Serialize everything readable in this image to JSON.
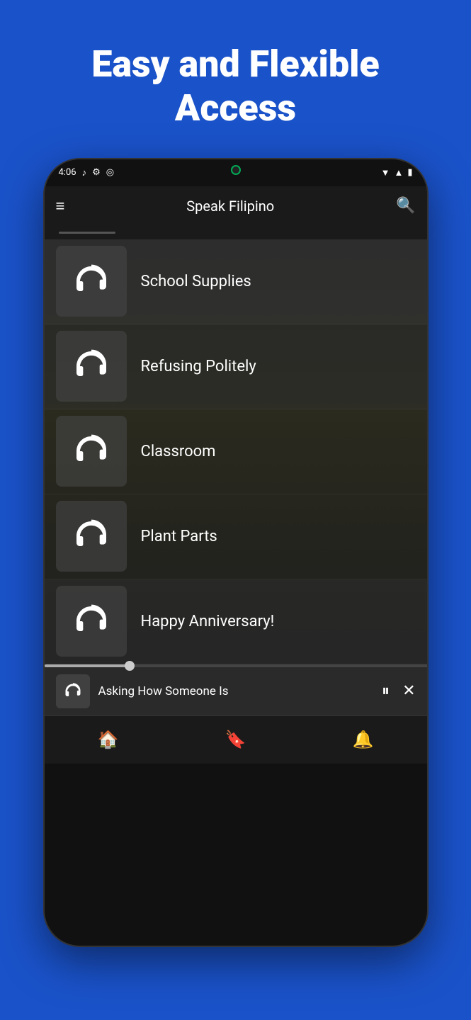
{
  "hero": {
    "title": "Easy and Flexible Access"
  },
  "statusBar": {
    "time": "4:06",
    "leftIcons": [
      "♪",
      "⚙",
      "◎"
    ],
    "rightIcons": [
      "▼",
      "▲",
      "🔋"
    ]
  },
  "appBar": {
    "title": "Speak Filipino",
    "menuLabel": "≡",
    "searchLabel": "🔍"
  },
  "listItems": [
    {
      "id": 1,
      "label": "School Supplies"
    },
    {
      "id": 2,
      "label": "Refusing Politely"
    },
    {
      "id": 3,
      "label": "Classroom"
    },
    {
      "id": 4,
      "label": "Plant Parts"
    },
    {
      "id": 5,
      "label": "Happy Anniversary!"
    }
  ],
  "player": {
    "title": "Asking How Someone Is",
    "progressPercent": 22,
    "pauseLabel": "⏸",
    "closeLabel": "✕"
  },
  "bottomNav": {
    "items": [
      {
        "id": "home",
        "icon": "🏠"
      },
      {
        "id": "bookmark",
        "icon": "🔖"
      },
      {
        "id": "bell",
        "icon": "🔔"
      }
    ]
  },
  "colors": {
    "background": "#1a52c9",
    "phoneBg": "#111",
    "appBar": "#1a1a1a",
    "content": "#1e1e1e",
    "accent": "#aaaaaa"
  }
}
